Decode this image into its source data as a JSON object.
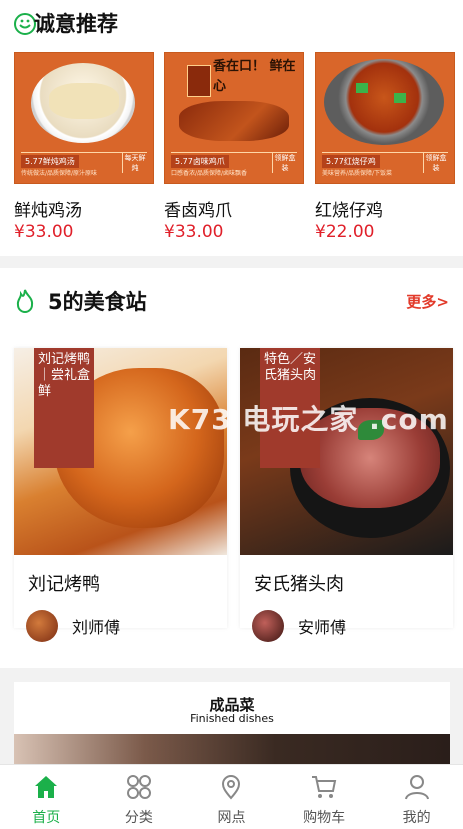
{
  "recommend": {
    "title": "诚意推荐",
    "products": [
      {
        "name": "鲜炖鸡汤",
        "price": "¥33.00",
        "promo": "5.77鲜炖鸡汤",
        "promo_sub": "传统做法/品质保障/原汁原味",
        "side": "每天鲜炖"
      },
      {
        "name": "香卤鸡爪",
        "price": "¥33.00",
        "promo": "5.77卤味鸡爪",
        "promo_sub": "口感香浓/品质保障/卤味飘香",
        "side": "领鲜盒装",
        "headline": "香在口！ 鲜在心"
      },
      {
        "name": "红烧仔鸡",
        "price": "¥22.00",
        "promo": "5.77红烧仔鸡",
        "promo_sub": "美味营养/品质保障/下饭菜",
        "side": "领鲜盒装"
      }
    ]
  },
  "station": {
    "title": "5的美食站",
    "more": "更多>",
    "cards": [
      {
        "title": "刘记烤鸭",
        "chef": "刘师傅",
        "banner": "刘记烤鸭｜尝礼盒鲜"
      },
      {
        "title": "安氏猪头肉",
        "chef": "安师傅",
        "banner": "特色／安氏猪头肉"
      }
    ]
  },
  "finished": {
    "title": "成品菜",
    "subtitle": "Finished dishes"
  },
  "watermark": "K73 电玩之家 .com",
  "tabs": [
    {
      "label": "首页",
      "icon": "home-icon",
      "active": true
    },
    {
      "label": "分类",
      "icon": "category-icon"
    },
    {
      "label": "网点",
      "icon": "location-icon"
    },
    {
      "label": "购物车",
      "icon": "cart-icon"
    },
    {
      "label": "我的",
      "icon": "user-icon"
    }
  ],
  "colors": {
    "accent": "#1bb04a",
    "price": "#e0202a",
    "more": "#e23a2a",
    "promo_bg": "#d9662a"
  }
}
